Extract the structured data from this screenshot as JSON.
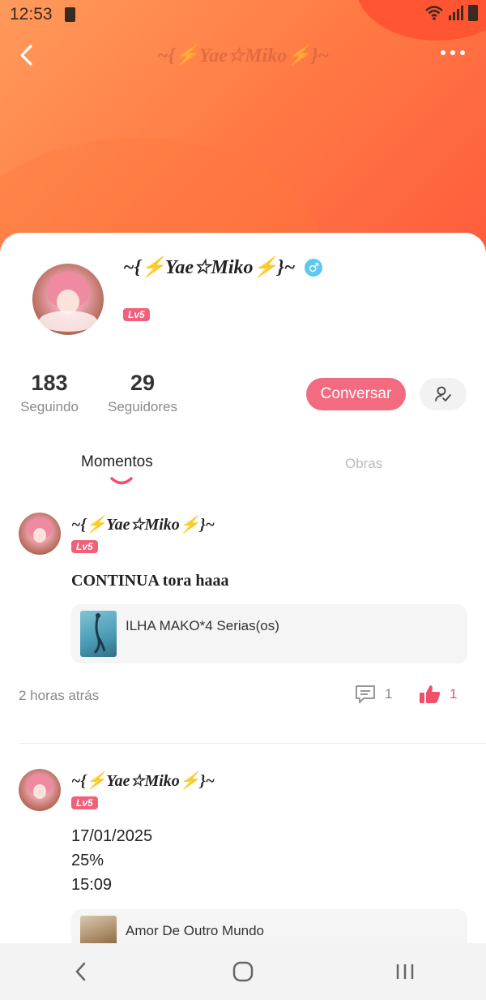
{
  "status_bar": {
    "time": "12:53"
  },
  "header": {
    "title": "~{⚡Yae☆Miko⚡}~"
  },
  "profile": {
    "name": "~{⚡Yae☆Miko⚡}~",
    "gender_symbol": "♂",
    "level": "Lv5",
    "following_count": "183",
    "following_label": "Seguindo",
    "followers_count": "29",
    "followers_label": "Seguidores",
    "chat_label": "Conversar"
  },
  "tabs": [
    {
      "label": "Momentos",
      "active": true
    },
    {
      "label": "Obras",
      "active": false
    }
  ],
  "posts": [
    {
      "author": "~{⚡Yae☆Miko⚡}~",
      "level": "Lv5",
      "text": "CONTINUA tora haaa",
      "attachment_title": "ILHA MAKO*4 Serias(os)",
      "time": "2 horas atrás",
      "comments": "1",
      "likes": "1"
    },
    {
      "author": "~{⚡Yae☆Miko⚡}~",
      "level": "Lv5",
      "lines": [
        "17/01/2025",
        "25%",
        "15:09"
      ],
      "attachment_title": "Amor De Outro Mundo"
    }
  ],
  "colors": {
    "accent": "#f26b80",
    "header_gradient_start": "#ff9a5a",
    "header_gradient_end": "#ff5c3c"
  }
}
